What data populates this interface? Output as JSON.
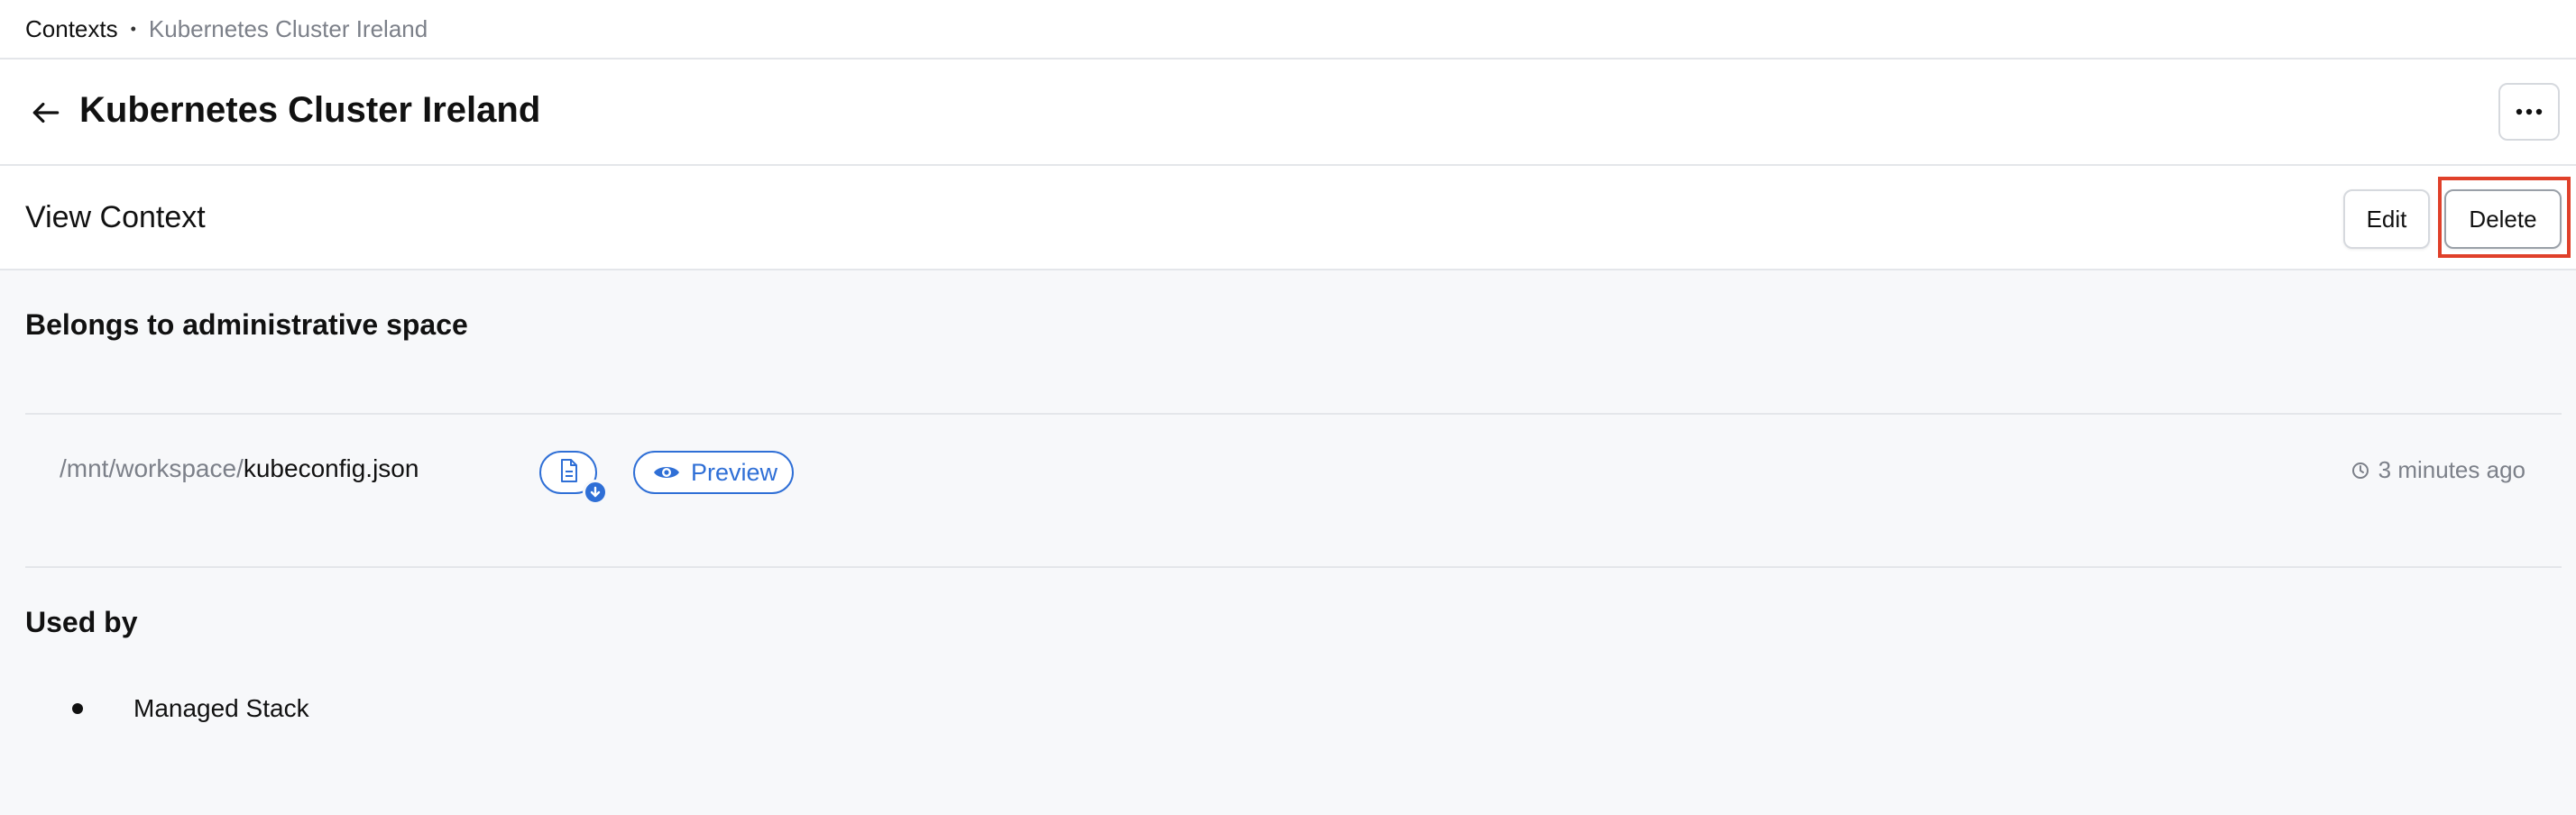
{
  "breadcrumb": {
    "root": "Contexts",
    "separator": "•",
    "current": "Kubernetes Cluster Ireland"
  },
  "header": {
    "title": "Kubernetes Cluster Ireland",
    "back_icon": "arrow-left-icon",
    "more_icon": "ellipsis-icon"
  },
  "view": {
    "title": "View Context",
    "edit_label": "Edit",
    "delete_label": "Delete"
  },
  "space": {
    "title": "Belongs to administrative space"
  },
  "file": {
    "path_prefix": "/mnt/workspace/",
    "file_name": "kubeconfig.json",
    "download_icon": "file-download-icon",
    "preview_label": "Preview",
    "preview_icon": "eye-icon",
    "timestamp": "3 minutes ago",
    "timestamp_icon": "clock-icon"
  },
  "used_by": {
    "title": "Used by",
    "items": [
      "Managed Stack"
    ]
  },
  "colors": {
    "accent": "#2f6fd6",
    "highlight": "#e0402a",
    "muted_text": "#7c8089"
  }
}
